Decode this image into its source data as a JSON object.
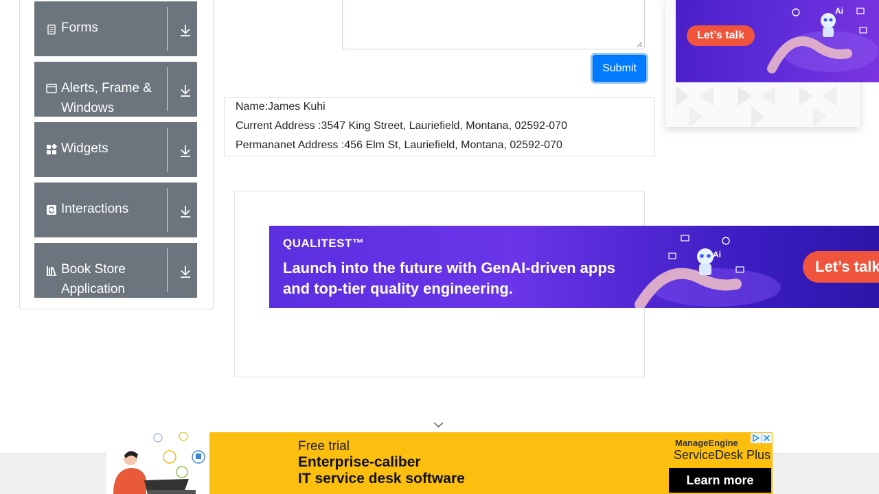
{
  "sidebar": {
    "groups": [
      {
        "label": "Forms",
        "icon": "form-icon"
      },
      {
        "label": "Alerts, Frame & Windows",
        "icon": "window-icon"
      },
      {
        "label": "Widgets",
        "icon": "widgets-icon"
      },
      {
        "label": "Interactions",
        "icon": "interactions-icon"
      },
      {
        "label": "Book Store Application",
        "icon": "books-icon"
      }
    ],
    "group_action_icon": "download-arrow-icon"
  },
  "form": {
    "submit_label": "Submit"
  },
  "output": {
    "name": "Name:James Kuhi",
    "current_address": "Current Address :3547 King Street, Lauriefield, Montana, 02592-070",
    "permanent_address": "Permananet Address :456 Elm St, Lauriefield, Montana, 02592-070"
  },
  "ads": {
    "right_top": {
      "cta": "Let’s talk",
      "badge": "Ai"
    },
    "middle_banner": {
      "brand": "QUALITEST™",
      "headline": "Launch into the future with GenAI-driven apps and top-tier quality engineering.",
      "cta": "Let’s talk",
      "badge": "Ai"
    },
    "bottom": {
      "line1": "Free trial",
      "line2": "Enterprise-caliber",
      "line3": "IT service desk software",
      "brand1": "ManageEngine",
      "brand2": "ServiceDesk Plus",
      "cta": "Learn more"
    }
  },
  "colors": {
    "sidebar_header": "#6c757d",
    "submit": "#007bff",
    "ad_orange": "#f0543c",
    "ad_purple": "#5b2bd8",
    "ad_yellow": "#fcbf0f"
  }
}
